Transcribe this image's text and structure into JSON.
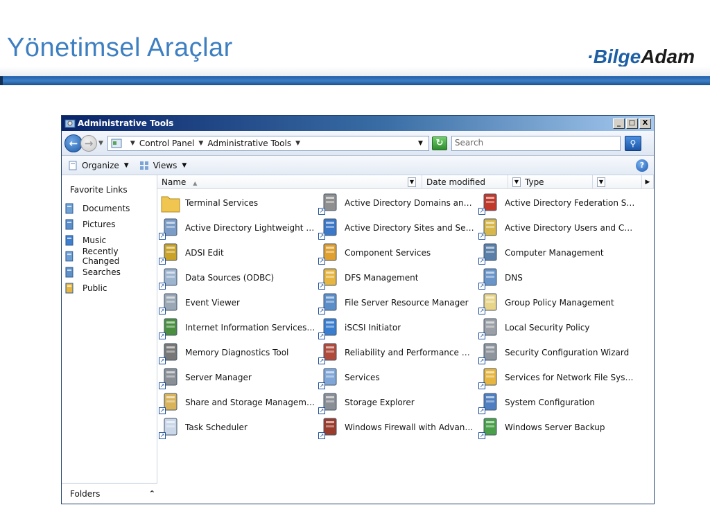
{
  "slide": {
    "title": "Yönetimsel Araçlar",
    "brand_part1": "·Bilge",
    "brand_part2": "Adam"
  },
  "window": {
    "title": "Administrative Tools",
    "controls": [
      "_",
      "□",
      "X"
    ]
  },
  "address": {
    "crumbs": [
      "Control Panel",
      "Administrative Tools"
    ],
    "search_placeholder": "Search"
  },
  "toolbar": {
    "organize": "Organize",
    "views": "Views"
  },
  "navpane": {
    "favorites_title": "Favorite Links",
    "favorites": [
      {
        "label": "Documents",
        "icon": "documents-icon"
      },
      {
        "label": "Pictures",
        "icon": "pictures-icon"
      },
      {
        "label": "Music",
        "icon": "music-icon"
      },
      {
        "label": "Recently Changed",
        "icon": "recently-changed-icon"
      },
      {
        "label": "Searches",
        "icon": "searches-icon"
      },
      {
        "label": "Public",
        "icon": "public-folder-icon"
      }
    ],
    "folders_label": "Folders"
  },
  "columns": {
    "name": "Name",
    "date_modified": "Date modified",
    "type": "Type"
  },
  "items": [
    {
      "label": "Terminal Services",
      "icon": "folder-icon"
    },
    {
      "label": "Active Directory Domains and T…",
      "icon": "ad-domains-icon"
    },
    {
      "label": "Active Directory Federation Ser…",
      "icon": "ad-federation-icon"
    },
    {
      "label": "Active Directory Lightweight Dir…",
      "icon": "ad-lightweight-icon"
    },
    {
      "label": "Active Directory Sites and Servi…",
      "icon": "ad-sites-icon"
    },
    {
      "label": "Active Directory Users and Co…",
      "icon": "ad-users-icon"
    },
    {
      "label": "ADSI Edit",
      "icon": "adsi-edit-icon"
    },
    {
      "label": "Component Services",
      "icon": "component-services-icon"
    },
    {
      "label": "Computer Management",
      "icon": "computer-management-icon"
    },
    {
      "label": "Data Sources (ODBC)",
      "icon": "odbc-icon"
    },
    {
      "label": "DFS Management",
      "icon": "dfs-icon"
    },
    {
      "label": "DNS",
      "icon": "dns-icon"
    },
    {
      "label": "Event Viewer",
      "icon": "event-viewer-icon"
    },
    {
      "label": "File Server Resource Manager",
      "icon": "file-server-icon"
    },
    {
      "label": "Group Policy Management",
      "icon": "group-policy-icon"
    },
    {
      "label": "Internet Information Services (…",
      "icon": "iis-icon"
    },
    {
      "label": "iSCSI Initiator",
      "icon": "iscsi-icon"
    },
    {
      "label": "Local Security Policy",
      "icon": "local-security-icon"
    },
    {
      "label": "Memory Diagnostics Tool",
      "icon": "memory-icon"
    },
    {
      "label": "Reliability and Performance Mo…",
      "icon": "reliability-icon"
    },
    {
      "label": "Security Configuration Wizard",
      "icon": "security-wizard-icon"
    },
    {
      "label": "Server Manager",
      "icon": "server-manager-icon"
    },
    {
      "label": "Services",
      "icon": "services-icon"
    },
    {
      "label": "Services for Network File Syste…",
      "icon": "nfs-icon"
    },
    {
      "label": "Share and Storage Management",
      "icon": "share-storage-icon"
    },
    {
      "label": "Storage Explorer",
      "icon": "storage-explorer-icon"
    },
    {
      "label": "System Configuration",
      "icon": "system-config-icon"
    },
    {
      "label": "Task Scheduler",
      "icon": "task-scheduler-icon"
    },
    {
      "label": "Windows Firewall with Advance…",
      "icon": "firewall-icon"
    },
    {
      "label": "Windows Server Backup",
      "icon": "backup-icon"
    }
  ]
}
